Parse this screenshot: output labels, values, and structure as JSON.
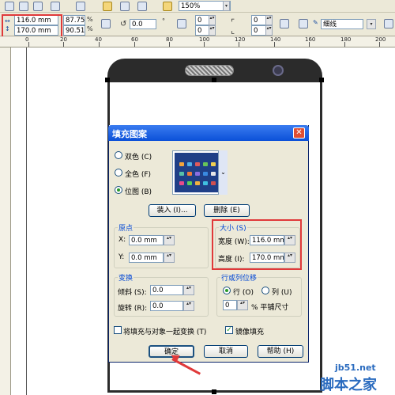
{
  "toolbar": {
    "zoom": "150%"
  },
  "property_bar": {
    "width": "116.0 mm",
    "height": "170.0 mm",
    "scale_x": "87.75",
    "scale_y": "90.51",
    "percent": "%",
    "rotation": "0.0",
    "degree": "°",
    "offset_a": "0",
    "offset_b": "0",
    "offset_c": "0",
    "offset_d": "0",
    "outline": "细线"
  },
  "ruler": {
    "ticks": [
      "0",
      "20",
      "40",
      "60",
      "80",
      "100",
      "120",
      "140",
      "160",
      "180",
      "200"
    ]
  },
  "dialog": {
    "title": "填充图案",
    "close": "✕",
    "radio_two_color": "双色 (C)",
    "radio_full_color": "全色 (F)",
    "radio_bitmap": "位图 (B)",
    "load_button": "装入 (I)...",
    "delete_button": "删除 (E)",
    "origin_label": "原点",
    "origin_x_label": "X:",
    "origin_x_value": "0.0  mm",
    "origin_y_label": "Y:",
    "origin_y_value": "0.0  mm",
    "size_label": "大小 (S)",
    "width_label": "宽度 (W):",
    "width_value": "116.0  mm",
    "height_label": "高度 (I):",
    "height_value": "170.0  mm",
    "transform_label": "变换",
    "skew_label": "倾斜 (S):",
    "skew_value": "0.0",
    "rotate_label": "旋转 (R):",
    "rotate_value": "0.0",
    "row_col_label": "行或列位移",
    "row_label": "行 (O)",
    "col_label": "列 (U)",
    "offset_value": "0",
    "offset_suffix": "%  平铺尺寸",
    "transform_with_object": "将填充与对象一起变换 (T)",
    "mirror_fill": "镜像填充",
    "ok_button": "确定",
    "cancel_button": "取消",
    "help_button": "帮助 (H)"
  },
  "watermark": {
    "site": "jb51.net",
    "name": "脚本之家"
  }
}
